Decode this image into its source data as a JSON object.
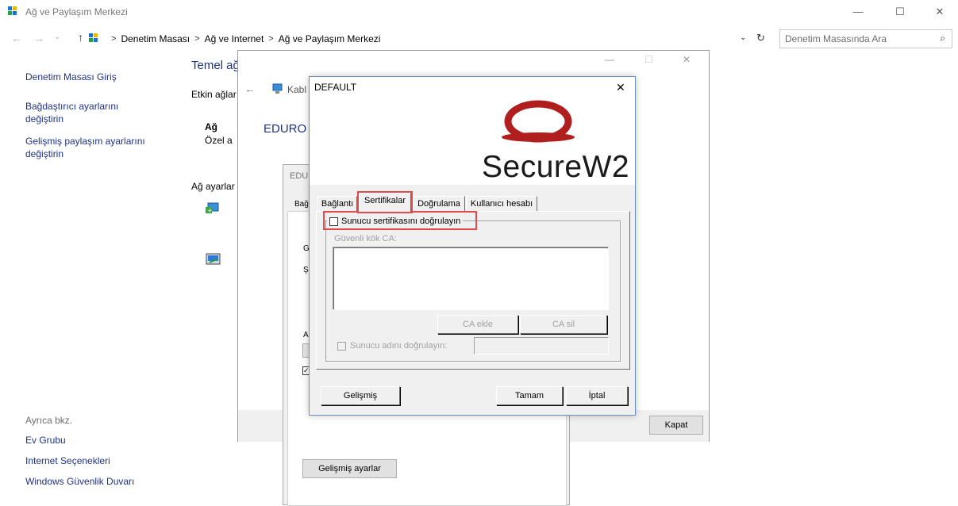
{
  "window": {
    "title": "Ağ ve Paylaşım Merkezi",
    "minimize_label": "—",
    "maximize_label": "☐",
    "close_label": "✕"
  },
  "address": {
    "crumbs": [
      "Denetim Masası",
      "Ağ ve Internet",
      "Ağ ve Paylaşım Merkezi"
    ],
    "search_placeholder": "Denetim Masasında Ara"
  },
  "sidebar": {
    "items": [
      {
        "label": "Denetim Masası Giriş"
      },
      {
        "label": "Bağdaştırıcı ayarlarını değiştirin"
      },
      {
        "label": "Gelişmiş paylaşım ayarlarını değiştirin"
      }
    ],
    "see_also_heading": "Ayrıca bkz.",
    "see_also": [
      {
        "label": "Ev Grubu"
      },
      {
        "label": "Internet Seçenekleri"
      },
      {
        "label": "Windows Güvenlik Duvarı"
      }
    ]
  },
  "main": {
    "heading_fragment": "Temel ağ",
    "active_networks_fragment": "Etkin ağlar",
    "network_name_fragment": "Ağ",
    "network_type_fragment": "Özel a",
    "settings_fragment": "Ağ ayarlar"
  },
  "back_window": {
    "title_fragment": "Kabl",
    "network_fragment": "EDURO",
    "close_button": "Kapat"
  },
  "mid_window": {
    "title_fragment": "EDU",
    "tab_fragment": "Bağ",
    "g_fragment": "G",
    "s_fragment": "Ş",
    "a_fragment": "A",
    "advanced_button": "Gelişmiş ayarlar"
  },
  "dialog": {
    "title": "DEFAULT",
    "brand": "SecureW2",
    "tabs": [
      {
        "label": "Bağlantı"
      },
      {
        "label": "Sertifikalar"
      },
      {
        "label": "Doğrulama"
      },
      {
        "label": "Kullanıcı hesabı"
      }
    ],
    "verify_server_cert": "Sunucu sertifikasını doğrulayın",
    "trusted_root_ca": "Güvenli kök CA:",
    "ca_add": "CA ekle",
    "ca_remove": "CA sil",
    "verify_server_name": "Sunucu adını doğrulayın:",
    "advanced": "Gelişmiş",
    "ok": "Tamam",
    "cancel": "İptal",
    "close": "✕"
  },
  "colors": {
    "link": "#1e3287",
    "highlight": "#e04b4b",
    "brand_red": "#b01e1e",
    "dialog_bg": "#f0f0f0"
  }
}
